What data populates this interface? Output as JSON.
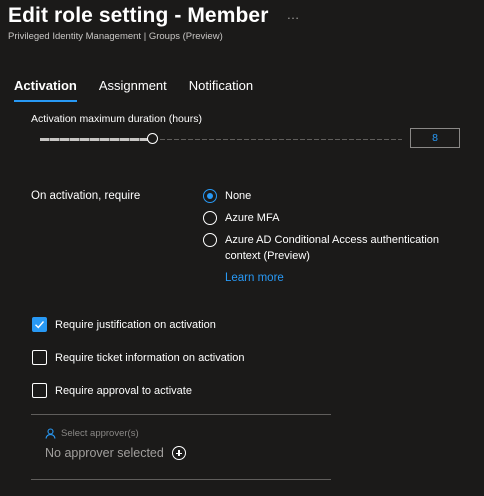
{
  "header": {
    "title": "Edit role setting - Member",
    "more_icon": "…",
    "subtitle": "Privileged Identity Management | Groups (Preview)"
  },
  "tabs": [
    {
      "label": "Activation",
      "active": true
    },
    {
      "label": "Assignment",
      "active": false
    },
    {
      "label": "Notification",
      "active": false
    }
  ],
  "activation": {
    "duration_label": "Activation maximum duration (hours)",
    "duration_value": "8",
    "require_label": "On activation, require",
    "options": [
      {
        "label": "None",
        "selected": true
      },
      {
        "label": "Azure MFA",
        "selected": false
      },
      {
        "label": "Azure AD Conditional Access authentication context (Preview)",
        "selected": false
      }
    ],
    "learn_more": "Learn more",
    "checkboxes": [
      {
        "label": "Require justification on activation",
        "checked": true
      },
      {
        "label": "Require ticket information on activation",
        "checked": false
      },
      {
        "label": "Require approval to activate",
        "checked": false
      }
    ],
    "approver_label": "Select approver(s)",
    "approver_value": "No approver selected"
  },
  "colors": {
    "accent": "#2899f5",
    "background": "#1b1a19"
  }
}
